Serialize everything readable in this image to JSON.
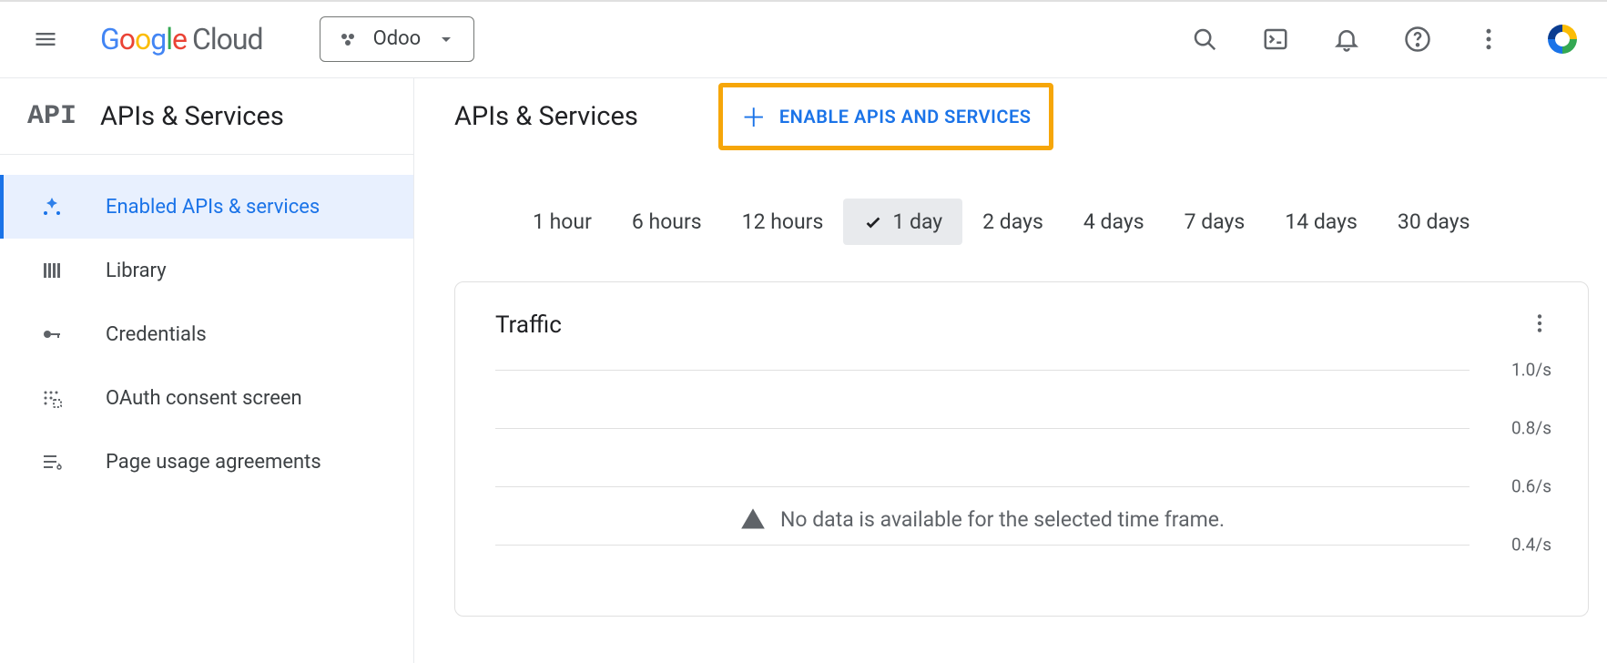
{
  "header": {
    "product_name_google": "Google",
    "product_name_cloud": "Cloud",
    "project_name": "Odoo"
  },
  "sidebar": {
    "section_title": "APIs & Services",
    "items": [
      {
        "label": "Enabled APIs & services",
        "active": true
      },
      {
        "label": "Library",
        "active": false
      },
      {
        "label": "Credentials",
        "active": false
      },
      {
        "label": "OAuth consent screen",
        "active": false
      },
      {
        "label": "Page usage agreements",
        "active": false
      }
    ]
  },
  "main": {
    "title": "APIs & Services",
    "enable_button": "ENABLE APIS AND SERVICES",
    "time_ranges": [
      "1 hour",
      "6 hours",
      "12 hours",
      "1 day",
      "2 days",
      "4 days",
      "7 days",
      "14 days",
      "30 days"
    ],
    "time_range_selected": "1 day",
    "card_title": "Traffic",
    "no_data_msg": "No data is available for the selected time frame."
  },
  "chart_data": {
    "type": "line",
    "title": "Traffic",
    "xlabel": "",
    "ylabel": "",
    "ylim": [
      0,
      1.0
    ],
    "y_ticks": [
      "1.0/s",
      "0.8/s",
      "0.6/s",
      "0.4/s"
    ],
    "series": [],
    "note": "No data is available for the selected time frame."
  }
}
